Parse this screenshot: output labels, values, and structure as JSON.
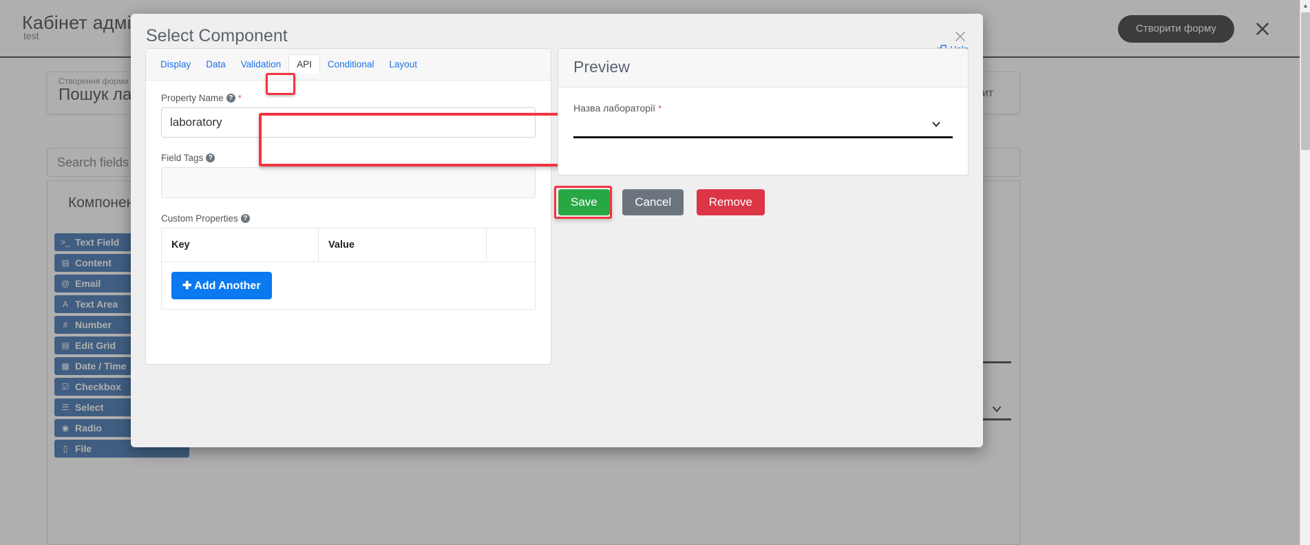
{
  "background": {
    "title": "Кабінет адміністратора",
    "subtitle": "test",
    "dark_button_label": "Створити форму",
    "close_icon": "close-icon",
    "card": {
      "kicker": "Створення форми",
      "heading": "Пошук лабораторії",
      "request_button_label": "Зробити запит"
    },
    "search_placeholder": "Search fields",
    "panel_title": "Компоненти",
    "components": [
      {
        "icon": ">_",
        "label": "Text Field"
      },
      {
        "icon": "▤",
        "label": "Content"
      },
      {
        "icon": "@",
        "label": "Email"
      },
      {
        "icon": "A",
        "label": "Text Area"
      },
      {
        "icon": "#",
        "label": "Number"
      },
      {
        "icon": "▤",
        "label": "Edit Grid"
      },
      {
        "icon": "▦",
        "label": "Date / Time"
      },
      {
        "icon": "☑",
        "label": "Checkbox"
      },
      {
        "icon": "☰",
        "label": "Select"
      },
      {
        "icon": "◉",
        "label": "Radio"
      },
      {
        "icon": "▯",
        "label": "File"
      }
    ]
  },
  "modal": {
    "title": "Select Component",
    "close_icon": "close-icon",
    "help_label": "Help",
    "help_icon": "external-window-icon",
    "tabs": [
      {
        "label": "Display",
        "active": false
      },
      {
        "label": "Data",
        "active": false
      },
      {
        "label": "Validation",
        "active": false
      },
      {
        "label": "API",
        "active": true
      },
      {
        "label": "Conditional",
        "active": false
      },
      {
        "label": "Layout",
        "active": false
      }
    ],
    "property_name": {
      "label": "Property Name",
      "required_marker": "*",
      "help_icon": "question-mark-icon",
      "value": "laboratory",
      "placeholder": ""
    },
    "field_tags": {
      "label": "Field Tags",
      "help_icon": "question-mark-icon",
      "value": "",
      "placeholder": ""
    },
    "custom_properties": {
      "label": "Custom Properties",
      "help_icon": "question-mark-icon",
      "columns": [
        "Key",
        "Value",
        ""
      ],
      "rows": [],
      "add_button_label": "Add Another",
      "add_button_icon": "plus-icon"
    },
    "preview": {
      "title": "Preview",
      "field_label": "Назва лабораторії",
      "required_marker": "*",
      "selected_value": "",
      "chevron_icon": "chevron-down-icon"
    },
    "actions": {
      "save_label": "Save",
      "cancel_label": "Cancel",
      "remove_label": "Remove"
    },
    "highlights": {
      "color": "#f5333f",
      "targets": [
        "api-tab",
        "property-name-field",
        "save-button"
      ]
    }
  },
  "colors": {
    "accent_blue": "#1a73e8",
    "add_button_blue": "#0b79ef",
    "save_green": "#28a745",
    "cancel_gray": "#6c757d",
    "remove_red": "#dc3545",
    "highlight_red": "#f5333f",
    "component_blue": "#0b4c9b"
  }
}
